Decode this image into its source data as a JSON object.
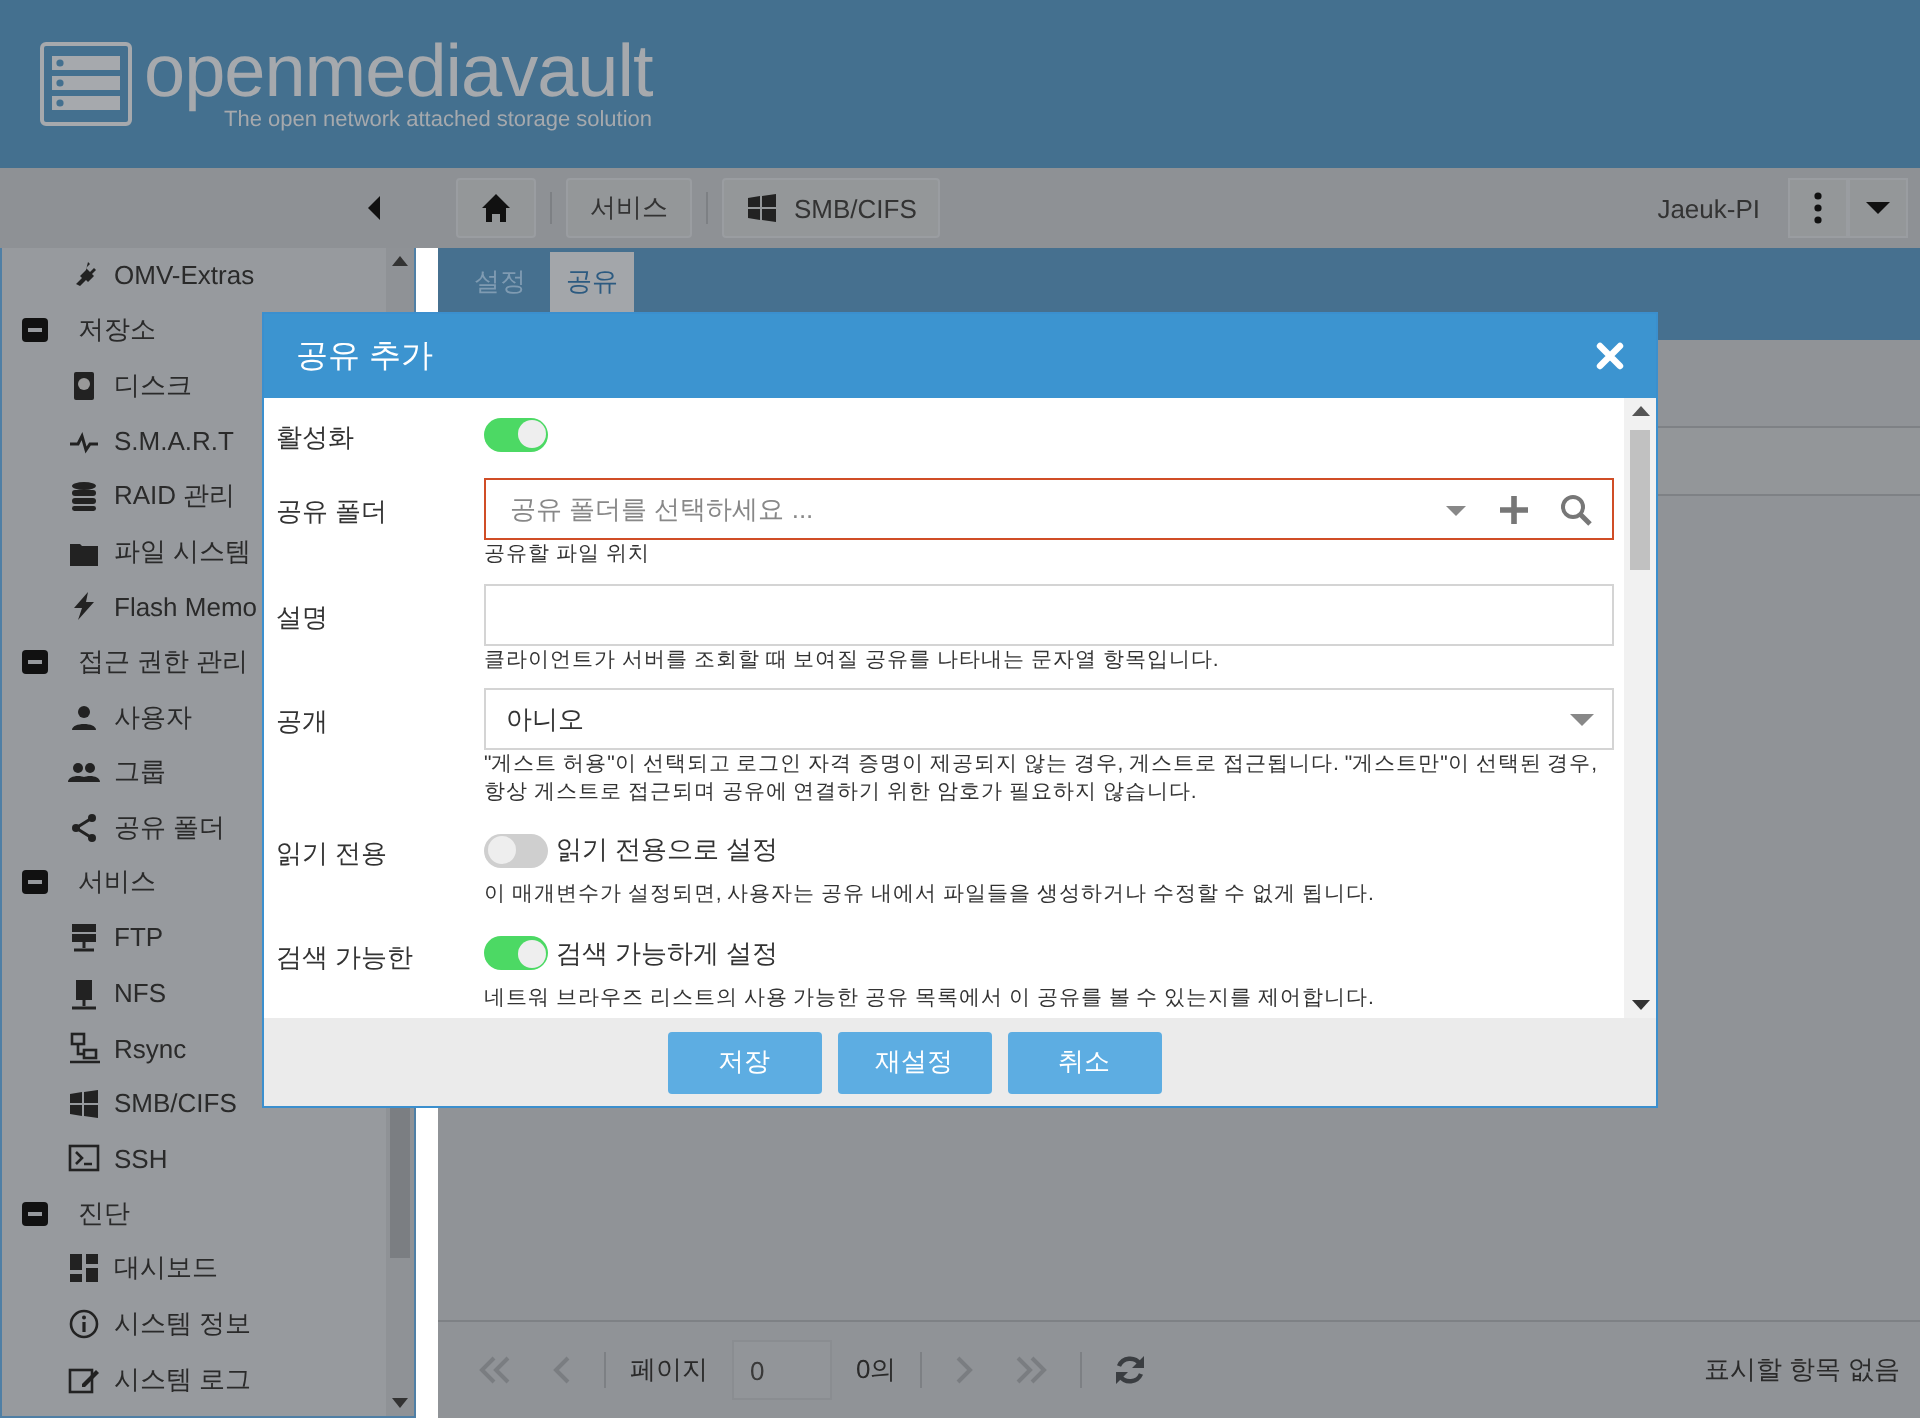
{
  "header": {
    "logo_text": "openmediavault",
    "tagline": "The open network attached storage solution"
  },
  "toolbar": {
    "breadcrumbs": [
      {
        "kind": "home"
      },
      {
        "kind": "text",
        "label": "서비스"
      },
      {
        "kind": "windows",
        "label": "SMB/CIFS"
      }
    ],
    "hostname": "Jaeuk-PI"
  },
  "sidebar": {
    "items": [
      {
        "expanded": true,
        "children": [
          {
            "label": "OMV-Extras"
          }
        ]
      },
      {
        "label": "저장소",
        "expanded": true,
        "children": [
          {
            "label": "디스크"
          },
          {
            "label": "S.M.A.R.T"
          },
          {
            "label": "RAID 관리"
          },
          {
            "label": "파일 시스템"
          },
          {
            "label": "Flash Memo"
          }
        ]
      },
      {
        "label": "접근 권한 관리",
        "expanded": true,
        "children": [
          {
            "label": "사용자"
          },
          {
            "label": "그룹"
          },
          {
            "label": "공유 폴더"
          }
        ]
      },
      {
        "label": "서비스",
        "expanded": true,
        "children": [
          {
            "label": "FTP"
          },
          {
            "label": "NFS"
          },
          {
            "label": "Rsync"
          },
          {
            "label": "SMB/CIFS"
          },
          {
            "label": "SSH"
          }
        ]
      },
      {
        "label": "진단",
        "expanded": true,
        "children": [
          {
            "label": "대시보드"
          },
          {
            "label": "시스템 정보"
          },
          {
            "label": "시스템 로그"
          }
        ]
      }
    ]
  },
  "tabs": [
    {
      "label": "설정",
      "selected": false
    },
    {
      "label": "공유",
      "selected": true
    }
  ],
  "dialog": {
    "title": "공유 추가",
    "fields": [
      {
        "kind": "toggle",
        "label": "활성화",
        "on": true
      },
      {
        "kind": "combo",
        "label": "공유 폴더",
        "placeholder": "공유 폴더를 선택하세요 ...",
        "invalid": true,
        "help": "공유할 파일 위치"
      },
      {
        "kind": "text",
        "label": "설명",
        "help": "클라이언트가 서버를 조회할 때 보여질 공유를 나타내는 문자열 항목입니다."
      },
      {
        "kind": "select",
        "label": "공개",
        "value": "아니오",
        "help": "\"게스트 허용\"이 선택되고 로그인 자격 증명이 제공되지 않는 경우, 게스트로 접근됩니다. \"게스트만\"이 선택된 경우, 항상 게스트로 접근되며 공유에 연결하기 위한 암호가 필요하지 않습니다."
      },
      {
        "kind": "toggle",
        "label": "읽기 전용",
        "on": false,
        "caption": "읽기 전용으로 설정",
        "help": "이 매개변수가 설정되면, 사용자는 공유 내에서 파일들을 생성하거나 수정할 수 없게 됩니다."
      },
      {
        "kind": "toggle",
        "label": "검색 가능한",
        "on": true,
        "caption": "검색 가능하게 설정",
        "help": "네트워 브라우즈 리스트의 사용 가능한 공유 목록에서 이 공유를 볼 수 있는지를 제어합니다."
      }
    ],
    "buttons": [
      "저장",
      "재설정",
      "취소"
    ]
  },
  "paging": {
    "page_label": "페이지",
    "page_value": "0",
    "of_label": "0의",
    "status": "표시할 항목 없음"
  }
}
